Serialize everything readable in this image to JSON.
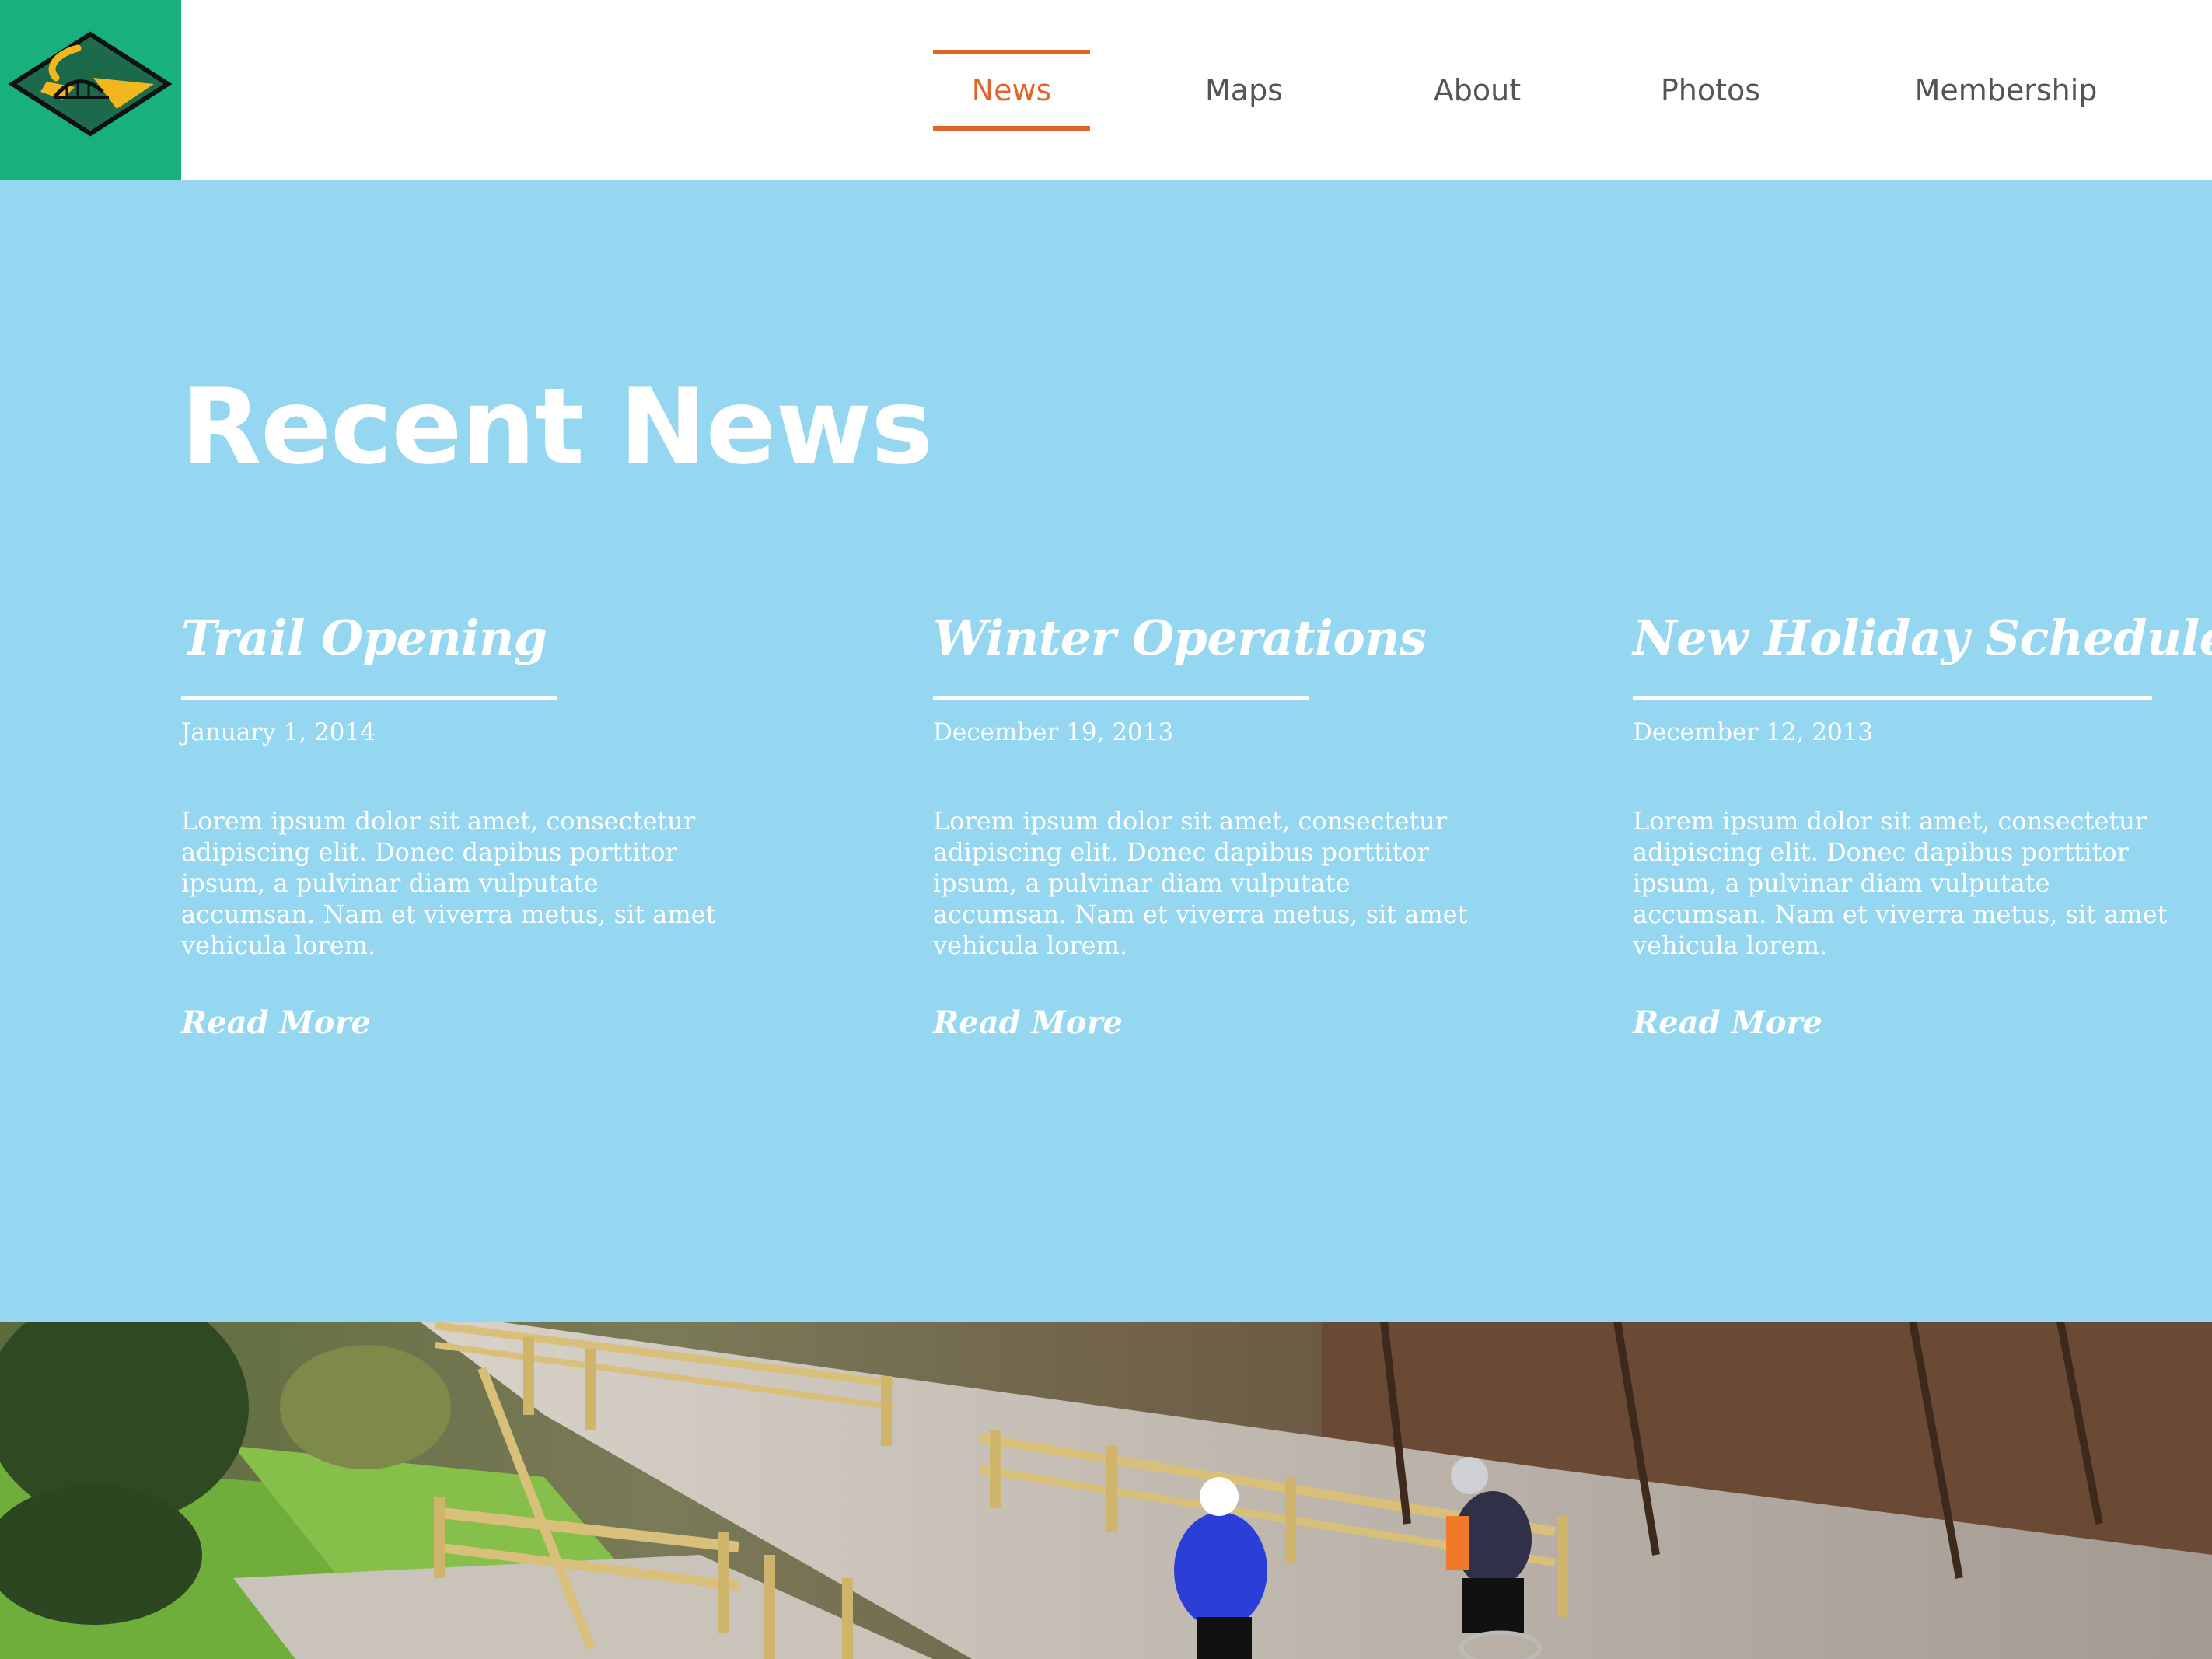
{
  "header": {
    "logo_alt": "trail-logo",
    "nav": [
      {
        "label": "News",
        "active": true
      },
      {
        "label": "Maps",
        "active": false
      },
      {
        "label": "About",
        "active": false
      },
      {
        "label": "Photos",
        "active": false
      },
      {
        "label": "Membership",
        "active": false
      }
    ]
  },
  "main": {
    "title": "Recent News",
    "articles": [
      {
        "title": "Trail Opening",
        "date": "January 1, 2014",
        "body": "Lorem ipsum dolor sit amet, consectetur adipiscing elit. Donec dapibus porttitor ipsum, a pulvinar diam vulputate accumsan. Nam et viverra metus, sit amet vehicula lorem.",
        "link": "Read More"
      },
      {
        "title": "Winter Operations",
        "date": "December 19, 2013",
        "body": "Lorem ipsum dolor sit amet, consectetur adipiscing elit. Donec dapibus porttitor ipsum, a pulvinar diam vulputate accumsan. Nam et viverra metus, sit amet vehicula lorem.",
        "link": "Read More"
      },
      {
        "title": "New Holiday Schedule",
        "date": "December 12, 2013",
        "body": "Lorem ipsum dolor sit amet, consectetur adipiscing elit. Donec dapibus porttitor ipsum, a pulvinar diam vulputate accumsan. Nam et viverra metus, sit amet vehicula lorem.",
        "link": "Read More"
      }
    ]
  },
  "colors": {
    "accent": "#e0652b",
    "logo_bg": "#18b07f",
    "news_bg": "#95d7f0",
    "nav_text": "#555555"
  }
}
